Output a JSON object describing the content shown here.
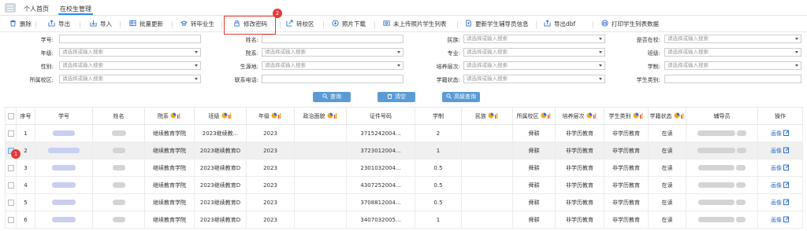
{
  "tabs": {
    "home": "个人首页",
    "active": "在校生管理"
  },
  "toolbar": {
    "delete": "删除",
    "export": "导出",
    "import": "导入",
    "batch_update": "批量更新",
    "graduate": "转毕业生",
    "change_password": "修改密码",
    "transfer": "转校区",
    "photo_download": "照片下载",
    "no_photo_list": "未上传照片学生列表",
    "update_counselor": "更新学生辅导员信息",
    "export_dbf": "导出dbf",
    "print_list": "打印学生列表数据"
  },
  "annotations": {
    "change_password_step": "2",
    "row_select_step": "1"
  },
  "filters": {
    "student_no": "学号:",
    "name": "姓名:",
    "ethnicity": "民族:",
    "in_school": "是否在校:",
    "grade": "年级:",
    "college": "院系:",
    "major": "专业:",
    "class": "班级:",
    "gender": "性别:",
    "source": "生源地:",
    "level": "培养层次:",
    "study_years": "学制:",
    "campus": "所属校区:",
    "phone": "联系电话:",
    "status": "学籍状态:",
    "category": "学生类别:",
    "placeholder": "请选择或输入搜索"
  },
  "actions": {
    "query": "查询",
    "clear": "清空",
    "advanced": "高级查询"
  },
  "table": {
    "headers": [
      "序号",
      "学号",
      "姓名",
      "院系",
      "班级",
      "年级",
      "政治面貌",
      "证件号码",
      "学制",
      "民族",
      "所属校区",
      "培养层次",
      "学生类别",
      "学籍状态",
      "辅导员",
      "操作"
    ],
    "rows": [
      {
        "no": "1",
        "college": "继续教育学院",
        "class": "2023继续教...",
        "grade": "2023",
        "id": "3715242004...",
        "years": "2",
        "campus": "舜耕",
        "level": "非学历教育",
        "type": "非学历教育",
        "status": "在读",
        "op": "画像"
      },
      {
        "no": "2",
        "college": "继续教育学院",
        "class": "2023继续教育D",
        "grade": "2023",
        "id": "3723012004...",
        "years": "1",
        "campus": "舜耕",
        "level": "非学历教育",
        "type": "非学历教育",
        "status": "在读",
        "op": "画像"
      },
      {
        "no": "3",
        "college": "继续教育学院",
        "class": "2023继续教育D",
        "grade": "2023",
        "id": "2301032004...",
        "years": "0.5",
        "campus": "舜耕",
        "level": "非学历教育",
        "type": "非学历教育",
        "status": "在读",
        "op": "画像"
      },
      {
        "no": "4",
        "college": "继续教育学院",
        "class": "2023继续教育D",
        "grade": "2023",
        "id": "4307252004...",
        "years": "0.5",
        "campus": "舜耕",
        "level": "非学历教育",
        "type": "非学历教育",
        "status": "在读",
        "op": "画像"
      },
      {
        "no": "5",
        "college": "继续教育学院",
        "class": "2023继续教育D",
        "grade": "2023",
        "id": "3708812004...",
        "years": "0.5",
        "campus": "舜耕",
        "level": "非学历教育",
        "type": "非学历教育",
        "status": "在读",
        "op": "画像"
      },
      {
        "no": "6",
        "college": "继续教育学院",
        "class": "2023继续教育D",
        "grade": "2023",
        "id": "3407032005...",
        "years": "1",
        "campus": "舜耕",
        "level": "非学历教育",
        "type": "非学历教育",
        "status": "在读",
        "op": "画像"
      }
    ]
  },
  "colors": {
    "accent": "#2d8cf0",
    "button": "#5b9bd5",
    "annotation": "#e53935"
  }
}
